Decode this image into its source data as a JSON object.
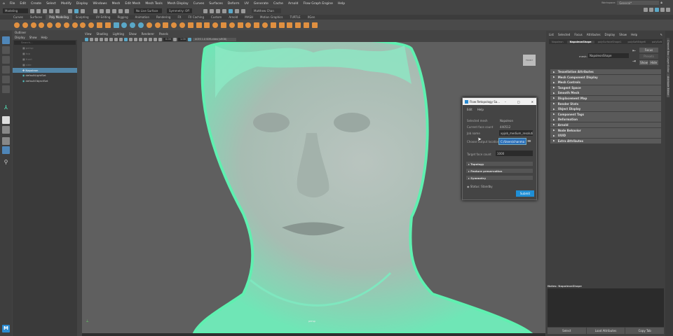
{
  "menubar": {
    "items": [
      "File",
      "Edit",
      "Create",
      "Select",
      "Modify",
      "Display",
      "Windows",
      "Mesh",
      "Edit Mesh",
      "Mesh Tools",
      "Mesh Display",
      "Curves",
      "Surfaces",
      "Deform",
      "UV",
      "Generate",
      "Cache",
      "Arnold",
      "Flow Graph Engine",
      "Help"
    ],
    "workspace_label": "Workspace:",
    "workspace_value": "General*"
  },
  "toolbar": {
    "mode": "Modeling",
    "live_surface": "No Live Surface",
    "symmetry": "Symmetry: Off",
    "user": "Matthew Chan"
  },
  "shelf": {
    "tabs": [
      "Curves",
      "Surfaces",
      "Poly Modeling",
      "Sculpting",
      "UV Editing",
      "Rigging",
      "Animation",
      "Rendering",
      "FX",
      "FX Caching",
      "Custom",
      "Arnold",
      "MASH",
      "Motion Graphics",
      "TURTLE",
      "XGen"
    ],
    "active": "Poly Modeling"
  },
  "outliner": {
    "title": "Outliner",
    "menu": [
      "Display",
      "Show",
      "Help"
    ],
    "search_placeholder": "Search...",
    "items": [
      {
        "label": "persp",
        "type": "camera"
      },
      {
        "label": "top",
        "type": "camera"
      },
      {
        "label": "front",
        "type": "camera"
      },
      {
        "label": "side",
        "type": "camera"
      },
      {
        "label": "Napoleon",
        "type": "mesh",
        "selected": true
      },
      {
        "label": "defaultLightSet",
        "type": "set"
      },
      {
        "label": "defaultObjectSet",
        "type": "set"
      }
    ]
  },
  "viewport": {
    "menu": [
      "View",
      "Shading",
      "Lighting",
      "Show",
      "Renderer",
      "Panels"
    ],
    "exposure": "0.00",
    "gamma": "1.00",
    "colorspace": "ACES 1.0 SDR-video (sRGB)",
    "view_cube": "FRONT",
    "camera_label": "persp",
    "wire_color": "#5ff0b0"
  },
  "dialog": {
    "title": "Flow Retopology Sa...",
    "menu": [
      "Edit",
      "Help"
    ],
    "selected_mesh_label": "Selected mesh",
    "selected_mesh": "Napoleon",
    "face_count_label": "Current face count",
    "face_count": "440512",
    "job_name_label": "Job name",
    "job_name": "xpjob_medium_resolution",
    "output_label": "Choose output location",
    "output_value": "C:/Users/chanma",
    "target_label": "Target face count",
    "target_value": "1000",
    "sections": [
      "Topology",
      "Feature preservation",
      "Symmetry"
    ],
    "status": "Status: Standby",
    "submit": "Submit",
    "accent": "#1f8fd6"
  },
  "attr": {
    "menu": [
      "List",
      "Selected",
      "Focus",
      "Attributes",
      "Display",
      "Show",
      "Help"
    ],
    "tabs": [
      "Napoleon",
      "NapoleonShape",
      "polySurfaceShape1",
      "polySoftEdge6",
      "polySoft"
    ],
    "active_tab": "NapoleonShape",
    "mesh_label": "mesh:",
    "mesh_value": "NapoleonShape",
    "focus": "Focus",
    "presets": "Presets",
    "show": "Show",
    "hide": "Hide",
    "sections": [
      "Tessellation Attributes",
      "Mesh Component Display",
      "Mesh Controls",
      "Tangent Space",
      "Smooth Mesh",
      "Displacement Map",
      "Render Stats",
      "Object Display",
      "Component Tags",
      "Deformation",
      "Arnold",
      "Node Behavior",
      "UUID",
      "Extra Attributes"
    ],
    "notes_label": "Notes: NapoleonShape",
    "buttons": [
      "Select",
      "Load Attributes",
      "Copy Tab"
    ]
  },
  "side_tabs": [
    "Channel Box / Layer Editor",
    "Attribute Editor"
  ]
}
